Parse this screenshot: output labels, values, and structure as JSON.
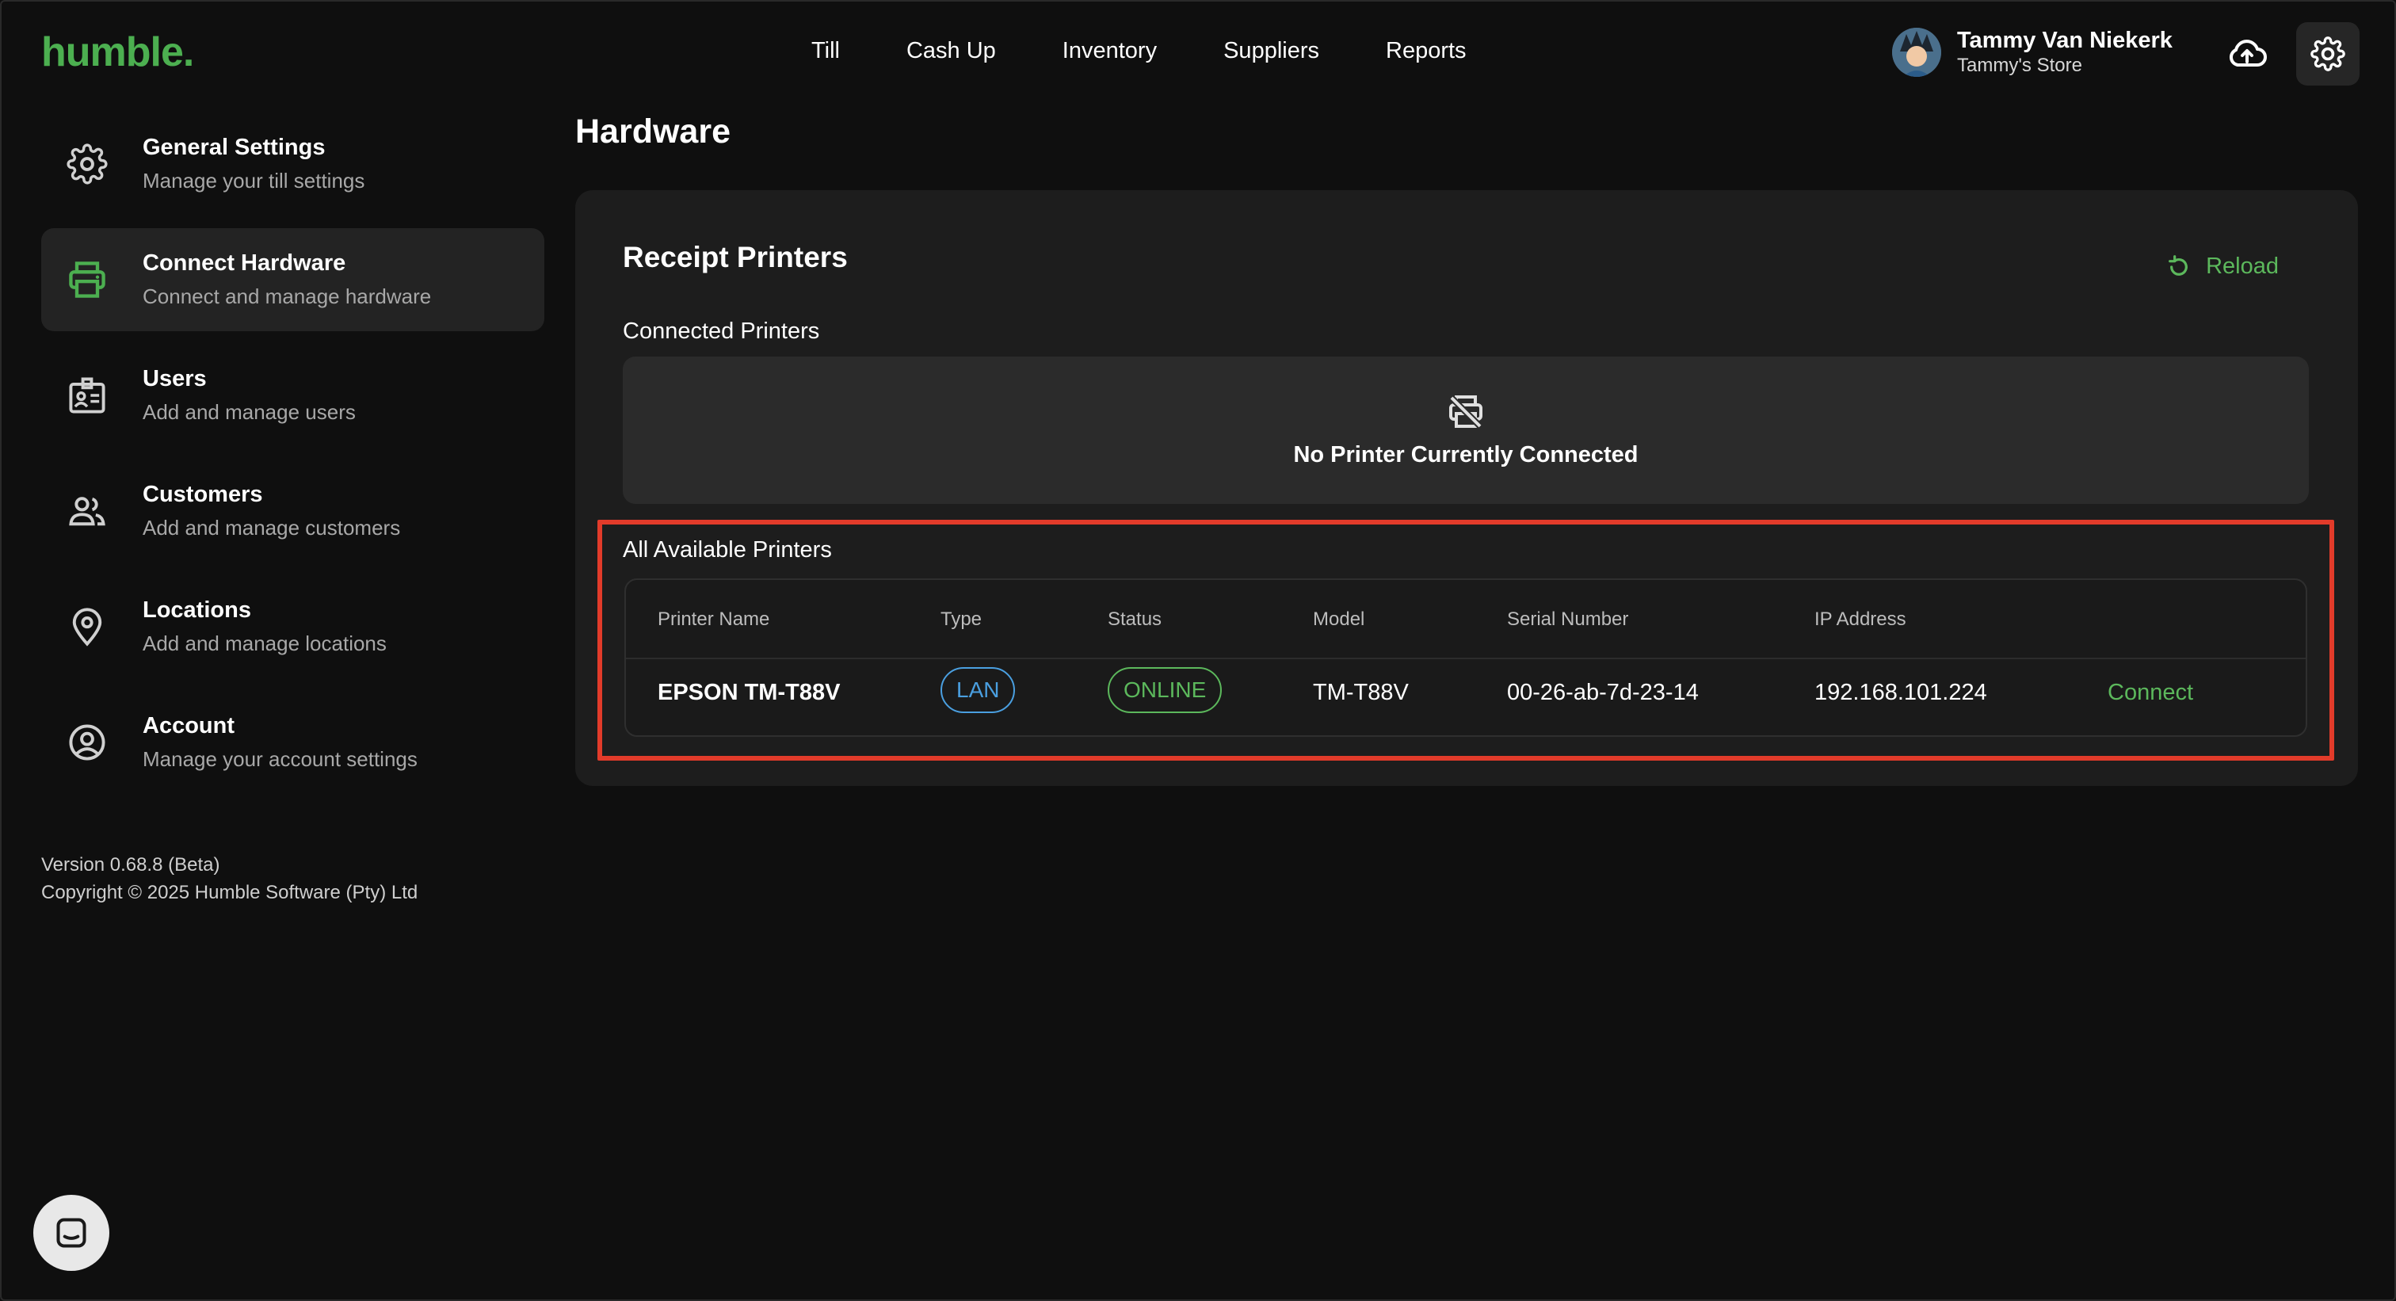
{
  "brand": {
    "logo": "humble."
  },
  "nav": {
    "items": [
      {
        "label": "Till"
      },
      {
        "label": "Cash Up"
      },
      {
        "label": "Inventory"
      },
      {
        "label": "Suppliers"
      },
      {
        "label": "Reports"
      }
    ]
  },
  "user": {
    "name": "Tammy Van Niekerk",
    "store": "Tammy's Store"
  },
  "sidebar": {
    "items": [
      {
        "title": "General Settings",
        "subtitle": "Manage your till settings",
        "icon": "gear-icon"
      },
      {
        "title": "Connect Hardware",
        "subtitle": "Connect and manage hardware",
        "icon": "printer-icon",
        "active": true
      },
      {
        "title": "Users",
        "subtitle": "Add and manage users",
        "icon": "id-badge-icon"
      },
      {
        "title": "Customers",
        "subtitle": "Add and manage customers",
        "icon": "people-icon"
      },
      {
        "title": "Locations",
        "subtitle": "Add and manage locations",
        "icon": "location-pin-icon"
      },
      {
        "title": "Account",
        "subtitle": "Manage your account settings",
        "icon": "account-circle-icon"
      }
    ],
    "version": "Version 0.68.8 (Beta)",
    "copyright": "Copyright © 2025 Humble Software (Pty) Ltd"
  },
  "page": {
    "title": "Hardware"
  },
  "receipt_printers": {
    "title": "Receipt Printers",
    "reload_label": "Reload",
    "connected_label": "Connected Printers",
    "no_printer_text": "No Printer Currently Connected",
    "available_label": "All Available Printers",
    "columns": [
      "Printer Name",
      "Type",
      "Status",
      "Model",
      "Serial Number",
      "IP Address"
    ],
    "rows": [
      {
        "name": "EPSON TM-T88V",
        "type": "LAN",
        "status": "ONLINE",
        "model": "TM-T88V",
        "serial": "00-26-ab-7d-23-14",
        "ip": "192.168.101.224",
        "action": "Connect"
      }
    ]
  },
  "colors": {
    "brand_green": "#4caf50",
    "highlight_red": "#e23b2a",
    "lan_blue": "#4a9fe0",
    "online_green": "#5cb85c"
  }
}
